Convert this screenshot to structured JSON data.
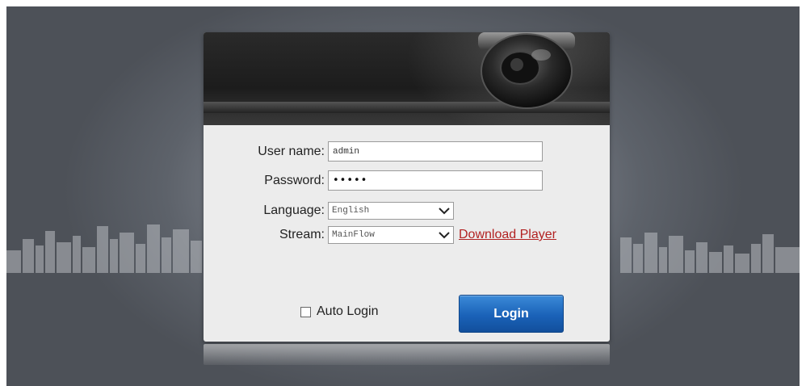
{
  "form": {
    "username_label": "User name:",
    "username_value": "admin",
    "password_label": "Password:",
    "password_masked": "•••••",
    "language_label": "Language:",
    "language_value": "English",
    "stream_label": "Stream:",
    "stream_value": "MainFlow",
    "download_player_link": "Download Player",
    "auto_login_label": "Auto Login",
    "auto_login_checked": false,
    "login_button": "Login"
  },
  "colors": {
    "link": "#b22222",
    "login_button": "#1a62b8",
    "panel": "#ececec"
  },
  "icons": {
    "banner": "dome-camera-icon",
    "dropdown": "chevron-down-icon"
  }
}
